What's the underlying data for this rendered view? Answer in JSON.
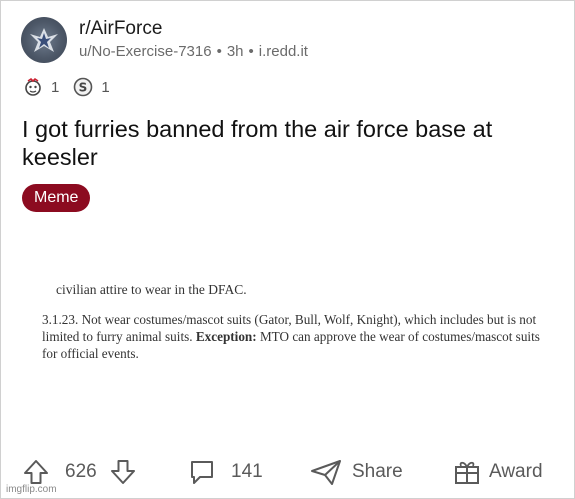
{
  "header": {
    "subreddit": "r/AirForce",
    "author": "u/No-Exercise-7316",
    "age": "3h",
    "domain": "i.redd.it",
    "separator": "•"
  },
  "awards": [
    {
      "icon": "gift-award-icon",
      "count": "1"
    },
    {
      "icon": "silver-award-icon",
      "count": "1"
    }
  ],
  "post": {
    "title": "I got furries banned from the air force base at keesler",
    "flair": "Meme",
    "flair_color": "#8c0b20"
  },
  "image": {
    "line1": "civilian attire to wear in the DFAC.",
    "para_main": "3.1.23. Not wear costumes/mascot suits (Gator, Bull, Wolf, Knight), which includes but is not limited to furry animal suits. ",
    "para_bold": "Exception:",
    "para_end": " MTO can approve the wear of costumes/mascot suits for official events."
  },
  "actions": {
    "upvotes": "626",
    "comments": "141",
    "share": "Share",
    "award": "Award"
  },
  "watermark": "imgflip.com"
}
